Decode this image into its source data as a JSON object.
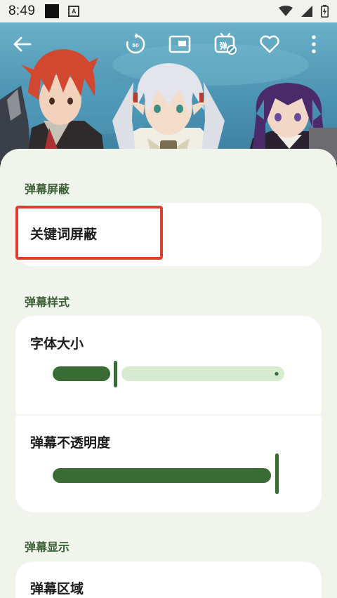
{
  "status_bar": {
    "time": "8:49",
    "app_icon_letter": "A",
    "icons": [
      "square-notification-icon",
      "app-notification-icon",
      "wifi-icon",
      "signal-icon",
      "battery-icon"
    ]
  },
  "top_bar": {
    "icons": [
      "back-arrow-icon",
      "replay-icon",
      "picture-in-picture-icon",
      "danmaku-toggle-icon",
      "favorite-heart-icon",
      "more-vert-icon"
    ],
    "replay_badge": "80",
    "danmaku_glyph": "弹"
  },
  "sheet": {
    "sections": {
      "block": {
        "title": "弹幕屏蔽",
        "item": "关键词屏蔽"
      },
      "style": {
        "title": "弹幕样式",
        "font_size": {
          "label": "字体大小",
          "value": 0.28
        },
        "opacity": {
          "label": "弹幕不透明度",
          "value": 1.0
        }
      },
      "display": {
        "title": "弹幕显示",
        "area_label": "弹幕区域"
      }
    }
  },
  "colors": {
    "accent": "#3a6b35",
    "track_inactive": "#d6ead0",
    "highlight": "#e03e2c",
    "section_title": "#3c6136",
    "sheet_bg": "#f1f4ec"
  }
}
